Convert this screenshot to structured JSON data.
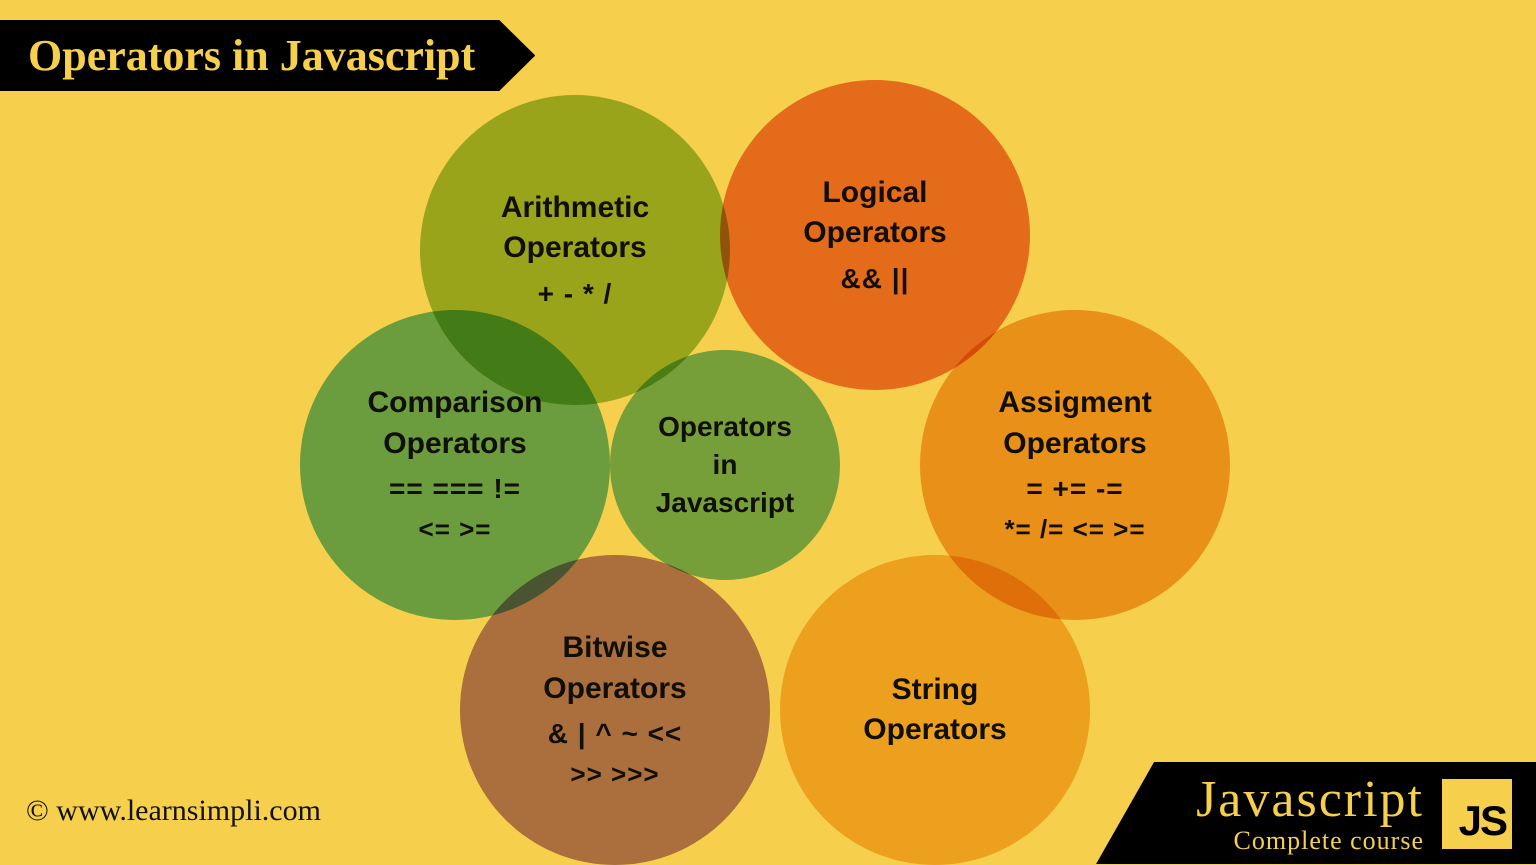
{
  "header": {
    "title": "Operators in Javascript"
  },
  "center": {
    "line1": "Operators",
    "line2": "in",
    "line3": "Javascript"
  },
  "circles": {
    "arithmetic": {
      "title1": "Arithmetic",
      "title2": "Operators",
      "ops": "+  -  *  /"
    },
    "logical": {
      "title1": "Logical",
      "title2": "Operators",
      "ops": "&&  ||"
    },
    "assignment": {
      "title1": "Assigment",
      "title2": "Operators",
      "ops": "=   +=   -=",
      "ops2": "*=  /=  <=  >="
    },
    "string": {
      "title1": "String",
      "title2": "Operators"
    },
    "bitwise": {
      "title1": "Bitwise",
      "title2": "Operators",
      "ops": "&  |  ^  ~  <<",
      "ops2": ">>  >>>"
    },
    "comparison": {
      "title1": "Comparison",
      "title2": "Operators",
      "ops": "==   ===   !=",
      "ops2": "<=  >="
    }
  },
  "footer": {
    "copyright": "© www.learnsimpli.com",
    "brand": "Javascript",
    "tagline": "Complete course",
    "logo": "JS"
  }
}
